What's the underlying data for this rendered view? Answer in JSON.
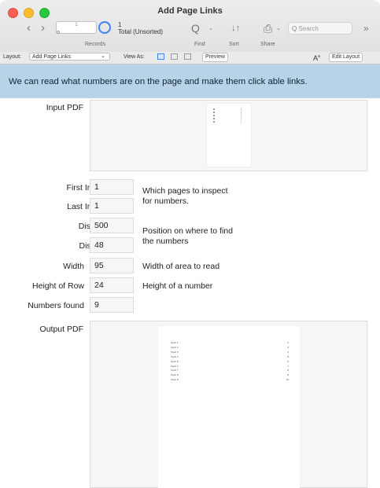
{
  "window": {
    "title": "Add Page Links"
  },
  "toolbar": {
    "record_slider_value": "1",
    "record_number": "1",
    "record_total": "Total (Unsorted)",
    "records_label": "Records",
    "find_label": "Find",
    "sort_label": "Sort",
    "share_label": "Share",
    "search_placeholder": "Search",
    "search_icon": "Q",
    "find_icon": "Q",
    "sort_icon": "↓↑",
    "share_icon": "⎙",
    "caret": "⌄",
    "more_icon": "»",
    "back_icon": "‹",
    "forward_icon": "›"
  },
  "layout_bar": {
    "layout_label": "Layout:",
    "layout_value": "Add Page Links",
    "layout_caret": "⌄",
    "view_as_label": "View As:",
    "preview_label": "Preview",
    "text_format_icon": "A",
    "text_format_sup": "a",
    "edit_layout_label": "Edit Layout"
  },
  "banner": {
    "text": "We can read what numbers are on the page and make them click able links."
  },
  "form": {
    "input_pdf_label": "Input PDF",
    "first_index_label": "First Index Page",
    "first_index_value": "1",
    "last_index_label": "Last Index Page",
    "last_index_value": "1",
    "pages_note": "Which pages to inspect for numbers.",
    "distance_left_label": "Distance Left",
    "distance_left_value": "500",
    "distance_top_label": "Distance Top",
    "distance_top_value": "48",
    "position_note": "Position on where to find the numbers",
    "width_label": "Width",
    "width_value": "95",
    "width_note": "Width of area to read",
    "height_label": "Height of Row",
    "height_value": "24",
    "height_note": "Height of a number",
    "numbers_found_label": "Numbers found",
    "numbers_found_value": "9",
    "output_pdf_label": "Output PDF"
  },
  "output_pdf": {
    "rows": [
      {
        "topic": "Topic 1",
        "page": "2"
      },
      {
        "topic": "Topic 2",
        "page": "3"
      },
      {
        "topic": "Topic 3",
        "page": "4"
      },
      {
        "topic": "Topic 4",
        "page": "5"
      },
      {
        "topic": "Topic 5",
        "page": "6"
      },
      {
        "topic": "Topic 6",
        "page": "7"
      },
      {
        "topic": "Topic 7",
        "page": "8"
      },
      {
        "topic": "Topic 8",
        "page": "9"
      },
      {
        "topic": "Topic 9",
        "page": "10"
      }
    ]
  },
  "colors": {
    "banner": "#b6d3e8",
    "accent": "#3a82f7",
    "field_bg": "#f6f6f6"
  }
}
